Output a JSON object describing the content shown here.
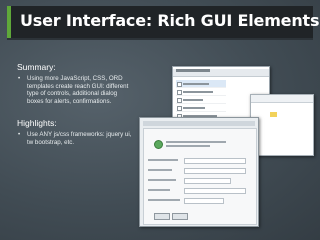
{
  "title": "User Interface: Rich GUI Elements",
  "summary": {
    "heading": "Summary:",
    "bullets": [
      "Using more JavaScript, CSS, ORD templates create reach GUI: different type of controls, additional dialog boxes for alerts, confirmations."
    ]
  },
  "highlights": {
    "heading": "Highlights:",
    "bullets": [
      "Use ANY js/css frameworks: jquery ui, tw bootstrap, etc."
    ]
  },
  "colors": {
    "title_bar": "#202427",
    "title_accent": "#5fa83a",
    "background": "#414c54"
  }
}
